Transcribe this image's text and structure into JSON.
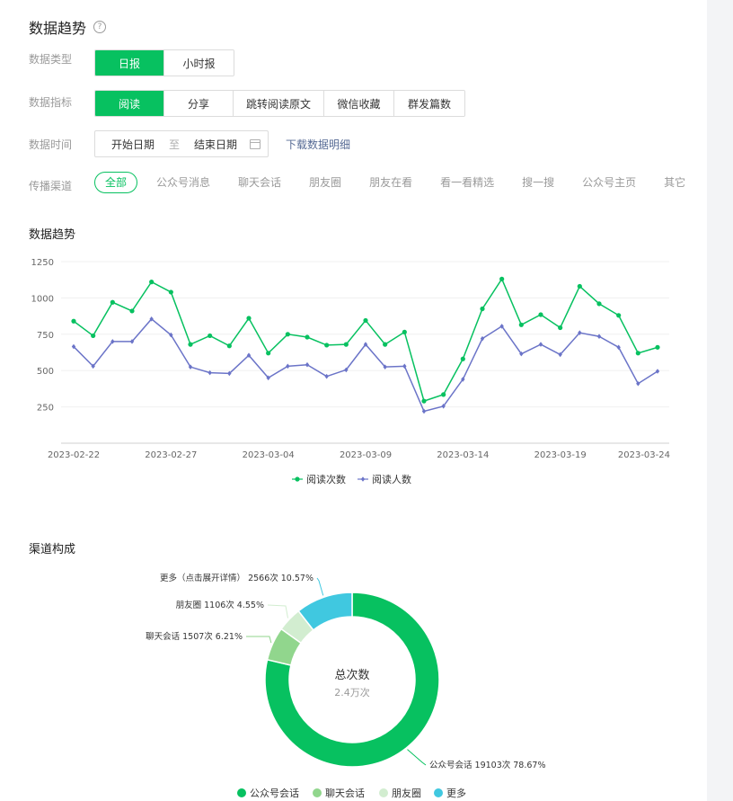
{
  "page": {
    "title": "数据趋势",
    "help_icon": "question-circle-icon"
  },
  "filters": {
    "type_label": "数据类型",
    "type_options": [
      "日报",
      "小时报"
    ],
    "metric_label": "数据指标",
    "metric_options": [
      "阅读",
      "分享",
      "跳转阅读原文",
      "微信收藏",
      "群发篇数"
    ],
    "time_label": "数据时间",
    "start_placeholder": "开始日期",
    "to_text": "至",
    "end_placeholder": "结束日期",
    "calendar_icon": "calendar-icon",
    "download_link": "下载数据明细",
    "channel_label": "传播渠道",
    "channels": [
      "全部",
      "公众号消息",
      "聊天会话",
      "朋友圈",
      "朋友在看",
      "看一看精选",
      "搜一搜",
      "公众号主页",
      "其它"
    ]
  },
  "trend_section": {
    "title": "数据趋势"
  },
  "colors": {
    "accent": "#07c160",
    "reads": "#07c160",
    "readers": "#6b74c8",
    "link": "#576b95"
  },
  "chart_data": [
    {
      "type": "line",
      "title": "数据趋势",
      "x": [
        "2023-02-22",
        "2023-02-23",
        "2023-02-24",
        "2023-02-25",
        "2023-02-26",
        "2023-02-27",
        "2023-02-28",
        "2023-03-01",
        "2023-03-02",
        "2023-03-03",
        "2023-03-04",
        "2023-03-05",
        "2023-03-06",
        "2023-03-07",
        "2023-03-08",
        "2023-03-09",
        "2023-03-10",
        "2023-03-11",
        "2023-03-12",
        "2023-03-13",
        "2023-03-14",
        "2023-03-15",
        "2023-03-16",
        "2023-03-17",
        "2023-03-18",
        "2023-03-19",
        "2023-03-20",
        "2023-03-21",
        "2023-03-22",
        "2023-03-23",
        "2023-03-24"
      ],
      "xticks": [
        "2023-02-22",
        "2023-02-27",
        "2023-03-04",
        "2023-03-09",
        "2023-03-14",
        "2023-03-19",
        "2023-03-24"
      ],
      "yticks": [
        250,
        500,
        750,
        1000,
        1250
      ],
      "ylim": [
        0,
        1250
      ],
      "series": [
        {
          "name": "阅读次数",
          "values": [
            840,
            740,
            970,
            910,
            1110,
            1040,
            680,
            740,
            670,
            860,
            620,
            750,
            730,
            675,
            680,
            845,
            680,
            765,
            290,
            335,
            580,
            925,
            1130,
            815,
            885,
            795,
            1080,
            960,
            880,
            620,
            660
          ]
        },
        {
          "name": "阅读人数",
          "values": [
            665,
            530,
            700,
            700,
            855,
            745,
            525,
            485,
            480,
            605,
            450,
            530,
            540,
            460,
            505,
            680,
            525,
            530,
            220,
            255,
            440,
            720,
            805,
            615,
            680,
            610,
            760,
            735,
            660,
            410,
            495
          ]
        }
      ],
      "legend": "bottom-center",
      "grid": true
    },
    {
      "type": "pie",
      "title": "渠道构成",
      "center_label": "总次数",
      "center_value": "2.4万次",
      "slices": [
        {
          "name": "公众号会话",
          "label": "公众号会话 19103次 78.67%",
          "value": 19103,
          "percent": 78.67,
          "color": "#07c160"
        },
        {
          "name": "聊天会话",
          "label": "聊天会话 1507次 6.21%",
          "value": 1507,
          "percent": 6.21,
          "color": "#91d68d"
        },
        {
          "name": "朋友圈",
          "label": "朋友圈 1106次 4.55%",
          "value": 1106,
          "percent": 4.55,
          "color": "#d2edd0"
        },
        {
          "name": "更多",
          "label": "更多（点击展开详情） 2566次 10.57%",
          "value": 2566,
          "percent": 10.57,
          "color": "#40c8e0"
        }
      ],
      "legend": "bottom-center"
    }
  ]
}
